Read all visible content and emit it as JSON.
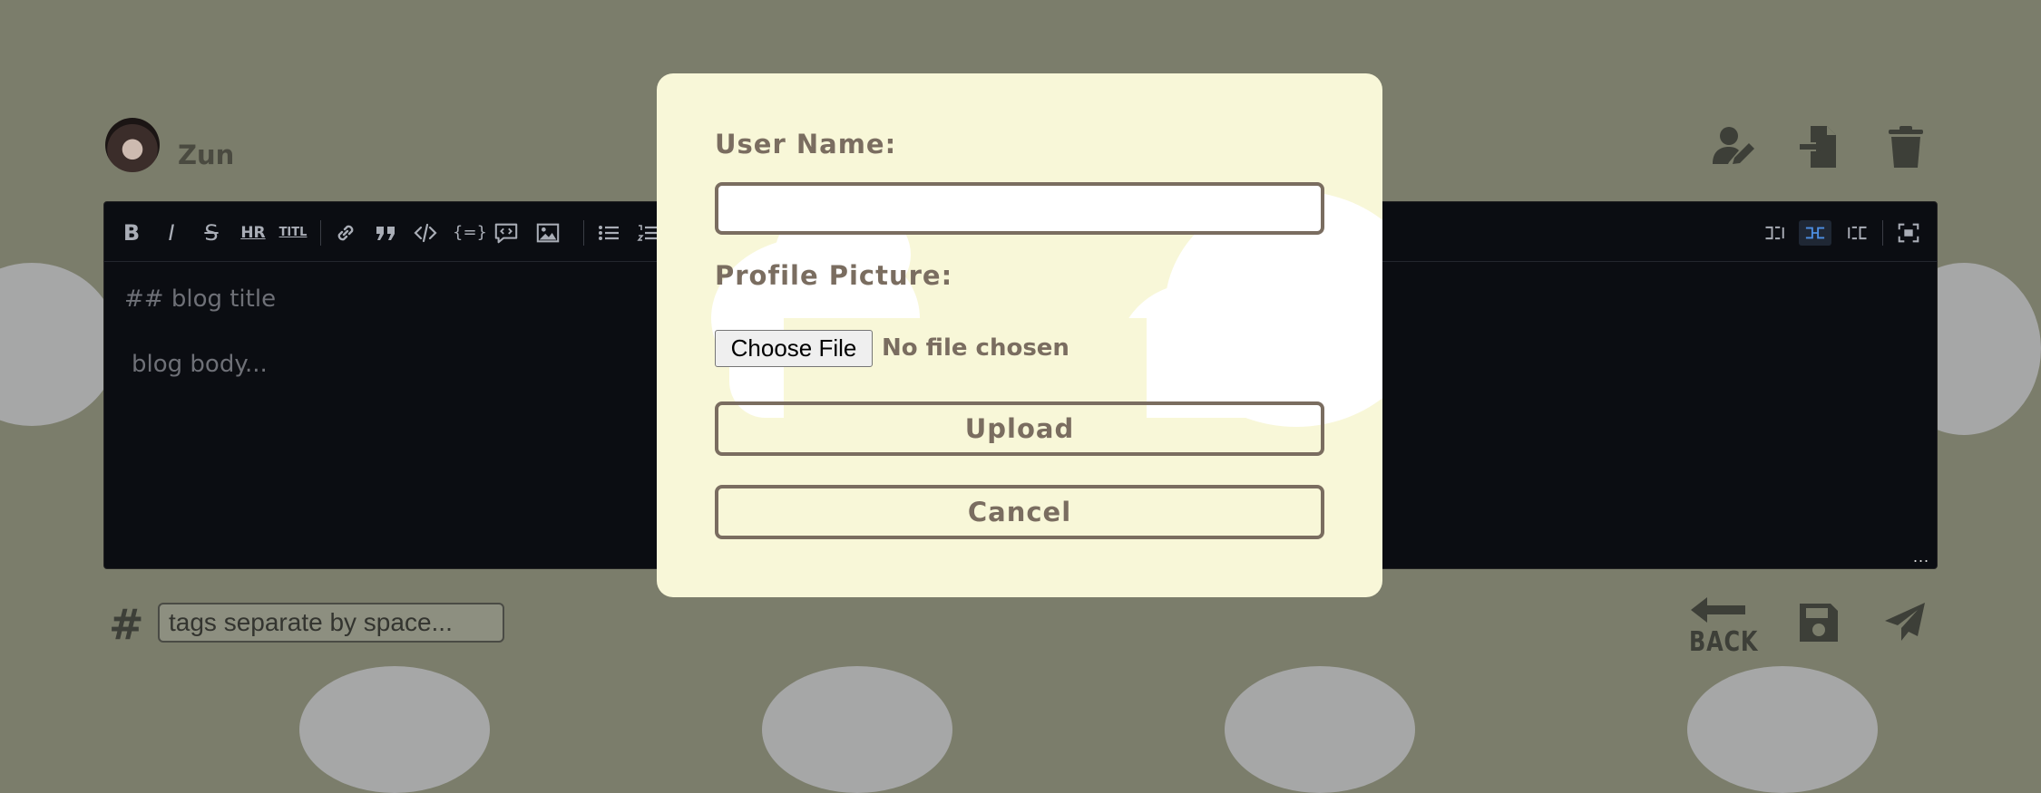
{
  "header": {
    "username": "Zun",
    "icons": [
      "user-edit-icon",
      "file-import-icon",
      "trash-icon"
    ]
  },
  "editor": {
    "toolbar": {
      "bold": "B",
      "italic": "I",
      "strike": "S",
      "hr": "HR",
      "title": "TITL",
      "code_block": "{=}"
    },
    "title_placeholder": "## blog title",
    "body_placeholder": "blog body...",
    "resize_dots": "..."
  },
  "bottom": {
    "hash": "#",
    "tags_placeholder": "tags separate by space...",
    "back_label": "BACK",
    "icons": [
      "back-arrow-icon",
      "save-icon",
      "send-icon"
    ]
  },
  "modal": {
    "username_label": "User Name:",
    "username_value": "",
    "picture_label": "Profile Picture:",
    "choose_file_label": "Choose File",
    "no_file_text": "No file chosen",
    "upload_label": "Upload",
    "cancel_label": "Cancel"
  },
  "colors": {
    "overlay_bg": "#7b7d6b",
    "modal_bg": "#f8f7d8",
    "modal_accent": "#7a6d60",
    "editor_bg": "#0b0d12",
    "active_toolbar": "#4d8fe3"
  }
}
